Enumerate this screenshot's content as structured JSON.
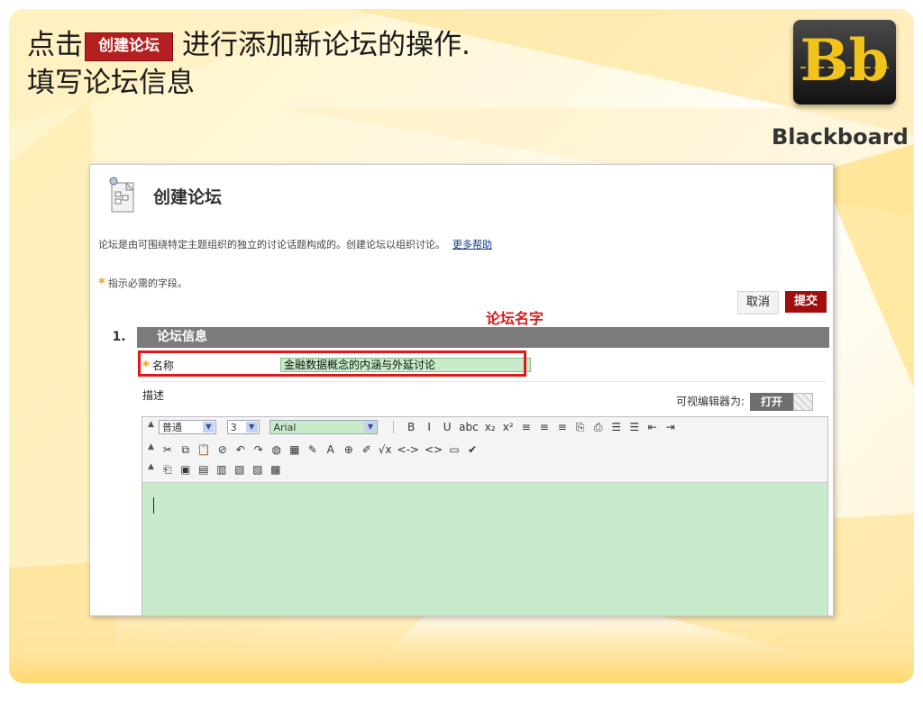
{
  "slide": {
    "title_line1_before": "点击",
    "title_inline_button": "创建论坛",
    "title_line1_after": "进行添加新论坛的操作.",
    "title_line2": "填写论坛信息"
  },
  "logo": {
    "mark": "Bb",
    "text": "Blackboard"
  },
  "colors": {
    "accent_red": "#b51f1f",
    "submit_red": "#a10e0e",
    "section_gray": "#7b7b7b",
    "editor_green": "#c7ebcb",
    "annotation_red": "#d81c1c",
    "required_star": "#f0a000"
  },
  "form": {
    "icon": "forum-page-icon",
    "title": "创建论坛",
    "instructions": "论坛是由可围绕特定主题组织的独立的讨论话题构成的。创建论坛以组织讨论。",
    "more_help": "更多帮助",
    "required_star": "*",
    "required_note": "指示必需的字段。",
    "cancel_label": "取消",
    "submit_label": "提交",
    "annotation": "论坛名字",
    "section": {
      "number": "1.",
      "title": "论坛信息"
    },
    "name_label": "名称",
    "name_value": "金融数据概念的内涵与外延讨论",
    "description_label": "描述",
    "editor_toggle_label": "可视编辑器为:",
    "editor_toggle_on": "打开"
  },
  "toolbar": {
    "style_value": "普通",
    "size_value": "3",
    "font_value": "Arial",
    "row1": [
      "B",
      "I",
      "U",
      "abc",
      "x₂",
      "x²",
      "≡",
      "≡",
      "≡",
      "⎘",
      "⎙",
      "☰",
      "☰",
      "⇤",
      "⇥"
    ],
    "row2": [
      "✂",
      "⧉",
      "📋",
      "⊘",
      "↶",
      "↷",
      "◍",
      "▦",
      "✎",
      "A",
      "⊕",
      "✐",
      "√x",
      "<->",
      "<>",
      "▭",
      "✔"
    ],
    "row3": [
      "⎗",
      "▣",
      "▤",
      "▥",
      "▧",
      "▨",
      "▩"
    ]
  }
}
